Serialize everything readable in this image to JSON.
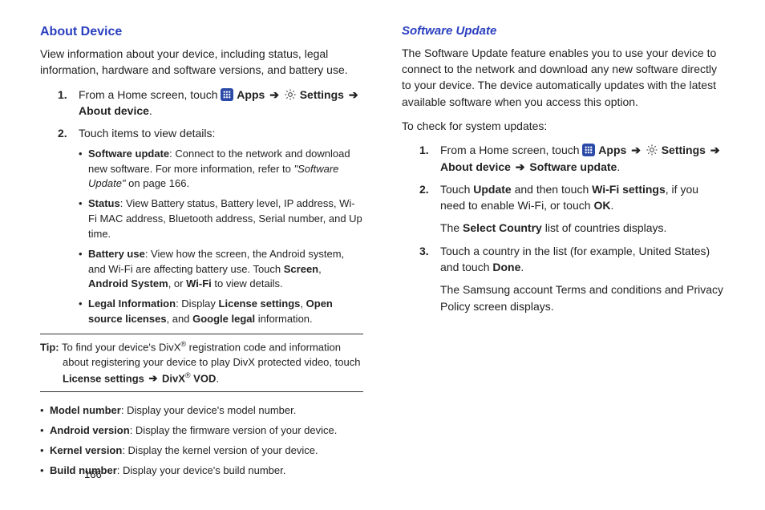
{
  "pageNumber": "166",
  "left": {
    "heading": "About Device",
    "intro": "View information about your device, including status, legal information, hardware and software versions, and battery use.",
    "step1_a": "From a Home screen, touch ",
    "apps_label": "Apps",
    "settings_label": "Settings",
    "step1_b": "About device",
    "step2": "Touch items to view details:",
    "bullets1": {
      "b1_bt": "Software update",
      "b1_t": ": Connect to the network and download new software. For more information, refer to ",
      "b1_ref": "\"Software Update\"",
      "b1_t2": "  on page 166.",
      "b2_bt": "Status",
      "b2_t": ": View Battery status, Battery level, IP address, Wi-Fi MAC address, Bluetooth address, Serial number, and Up time.",
      "b3_bt": "Battery use",
      "b3_t": ": View how the screen, the Android system, and Wi-Fi are affecting battery use. Touch ",
      "b3_s": "Screen",
      "b3_sep": ", ",
      "b3_a": "Android System",
      "b3_sep2": ", or ",
      "b3_w": "Wi-Fi",
      "b3_t2": " to view details.",
      "b4_bt": "Legal Information",
      "b4_t": ": Display ",
      "b4_ls": "License settings",
      "b4_sep": ", ",
      "b4_os": "Open source licenses",
      "b4_sep2": ", and ",
      "b4_gl": "Google legal",
      "b4_t2": " information."
    },
    "tip": {
      "label": "Tip:",
      "t1": " To find your device's DivX",
      "sup": "®",
      "t2": " registration code and information about registering your device to play DivX protected video, touch ",
      "ls": "License settings",
      "arrow": " ➔ ",
      "dv": "DivX",
      "vod": " VOD",
      "period": "."
    },
    "bullets2": {
      "b5_bt": "Model number",
      "b5_t": ": Display your device's model number.",
      "b6_bt": "Android version",
      "b6_t": ": Display the firmware version of your device.",
      "b7_bt": "Kernel version",
      "b7_t": ": Display the kernel version of your device.",
      "b8_bt": "Build number",
      "b8_t": ": Display your device's build number."
    }
  },
  "right": {
    "heading": "Software Update",
    "intro": "The Software Update feature enables you to use your device to connect to the network and download any new software directly to your device. The device automatically updates with the latest available software when you access this option.",
    "check": "To check for system updates:",
    "step1_a": "From a Home screen, touch ",
    "step1_ab": "About device",
    "step1_su": "Software update",
    "step2_a": "Touch ",
    "step2_u": "Update",
    "step2_b": " and then touch ",
    "step2_w": "Wi-Fi settings",
    "step2_c": ", if you need to enable Wi-Fi, or touch ",
    "step2_ok": "OK",
    "step2_d": ".",
    "step2f_a": "The ",
    "step2f_sc": "Select Country",
    "step2f_b": " list of countries displays.",
    "step3_a": "Touch a country in the list (for example, United States) and touch ",
    "step3_d": "Done",
    "step3_b": ".",
    "step3f": "The Samsung account Terms and conditions and Privacy Policy screen displays."
  }
}
